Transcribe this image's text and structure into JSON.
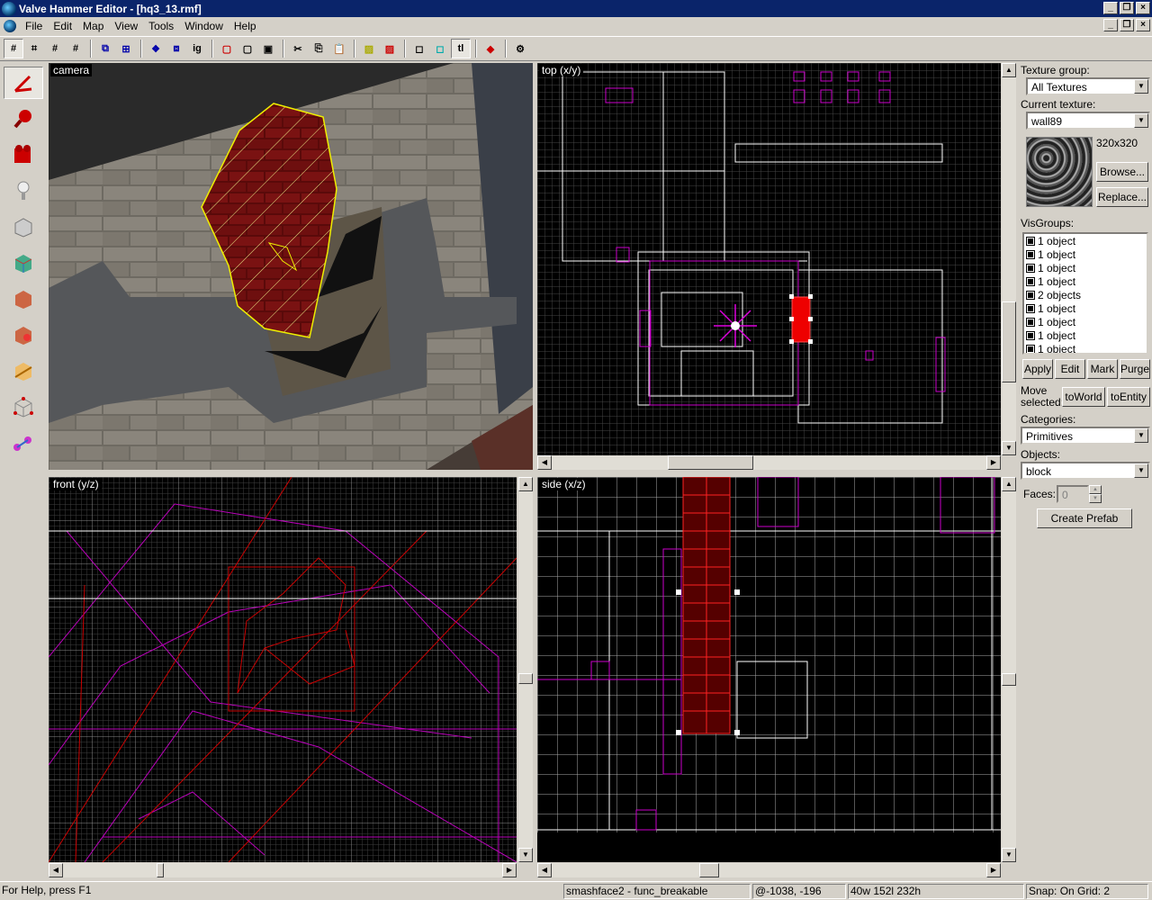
{
  "window": {
    "title": "Valve Hammer Editor - [hq3_13.rmf]"
  },
  "menu": [
    "File",
    "Edit",
    "Map",
    "View",
    "Tools",
    "Window",
    "Help"
  ],
  "toolbar": {
    "icons": [
      "grid-icon",
      "texture-lock-icon",
      "grid-smaller-icon",
      "grid-larger-icon",
      "load-window-state-icon",
      "group-icon",
      "ungroup-icon",
      "ignore-group-icon",
      "hide-selected-icon",
      "hide-unselected-icon",
      "show-all-icon",
      "cut-icon",
      "copy-icon",
      "paste-icon",
      "carve-icon",
      "make-hollow-icon",
      "to-world-icon",
      "to-entity-icon",
      "texture-lock-toggle-icon",
      "run-map-icon",
      "options-icon"
    ],
    "ig_label": "ig",
    "tl_label": "tl"
  },
  "left_tools": [
    "selection-tool-icon",
    "magnify-tool-icon",
    "camera-tool-icon",
    "entity-tool-icon",
    "block-tool-icon",
    "texture-application-icon",
    "apply-current-texture-icon",
    "decal-tool-icon",
    "clipping-tool-icon",
    "vertex-tool-icon",
    "path-tool-icon"
  ],
  "viewports": {
    "camera": "camera",
    "top": "top (x/y)",
    "front": "front (y/z)",
    "side": "side (x/z)"
  },
  "right_panel": {
    "texture_group_label": "Texture group:",
    "texture_group_value": "All Textures",
    "current_texture_label": "Current texture:",
    "current_texture_value": "wall89",
    "texture_size": "320x320",
    "browse": "Browse...",
    "replace": "Replace...",
    "visgroups_label": "VisGroups:",
    "visgroups": [
      "1 object",
      "1 object",
      "1 object",
      "1 object",
      "2 objects",
      "1 object",
      "1 object",
      "1 object",
      "1 object"
    ],
    "apply": "Apply",
    "edit": "Edit",
    "mark": "Mark",
    "purge": "Purge",
    "move_selected": "Move selected:",
    "to_world": "toWorld",
    "to_entity": "toEntity",
    "categories_label": "Categories:",
    "categories_value": "Primitives",
    "objects_label": "Objects:",
    "objects_value": "block",
    "faces_label": "Faces:",
    "faces_value": "0",
    "create_prefab": "Create Prefab"
  },
  "status": {
    "help": "For Help, press F1",
    "selection": "smashface2 - func_breakable",
    "coords": "@-1038, -196",
    "size": "40w 152l 232h",
    "snap": "Snap: On Grid: 2"
  }
}
